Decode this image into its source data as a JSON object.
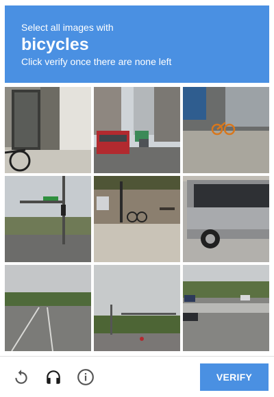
{
  "header": {
    "line1": "Select all images with",
    "target": "bicycles",
    "line2": "Click verify once there are none left",
    "bg_color": "#4a90e2"
  },
  "grid": {
    "tiles": [
      {
        "scene": "phone booth doorway with bicycle wheel at left"
      },
      {
        "scene": "city street with red bus and green bus"
      },
      {
        "scene": "sidewalk with orange bicycle near building"
      },
      {
        "scene": "intersection with traffic lights and overcast sky"
      },
      {
        "scene": "parking lot with parked bicycle and bench"
      },
      {
        "scene": "side of a silver tour bus"
      },
      {
        "scene": "highway with trees and cloudy sky"
      },
      {
        "scene": "road with traffic lights and trees"
      },
      {
        "scene": "highway with cars and palm trees"
      }
    ]
  },
  "footer": {
    "reload_icon": "reload-icon",
    "audio_icon": "headphones-icon",
    "info_icon": "info-icon",
    "verify_label": "VERIFY",
    "button_color": "#4a90e2"
  }
}
